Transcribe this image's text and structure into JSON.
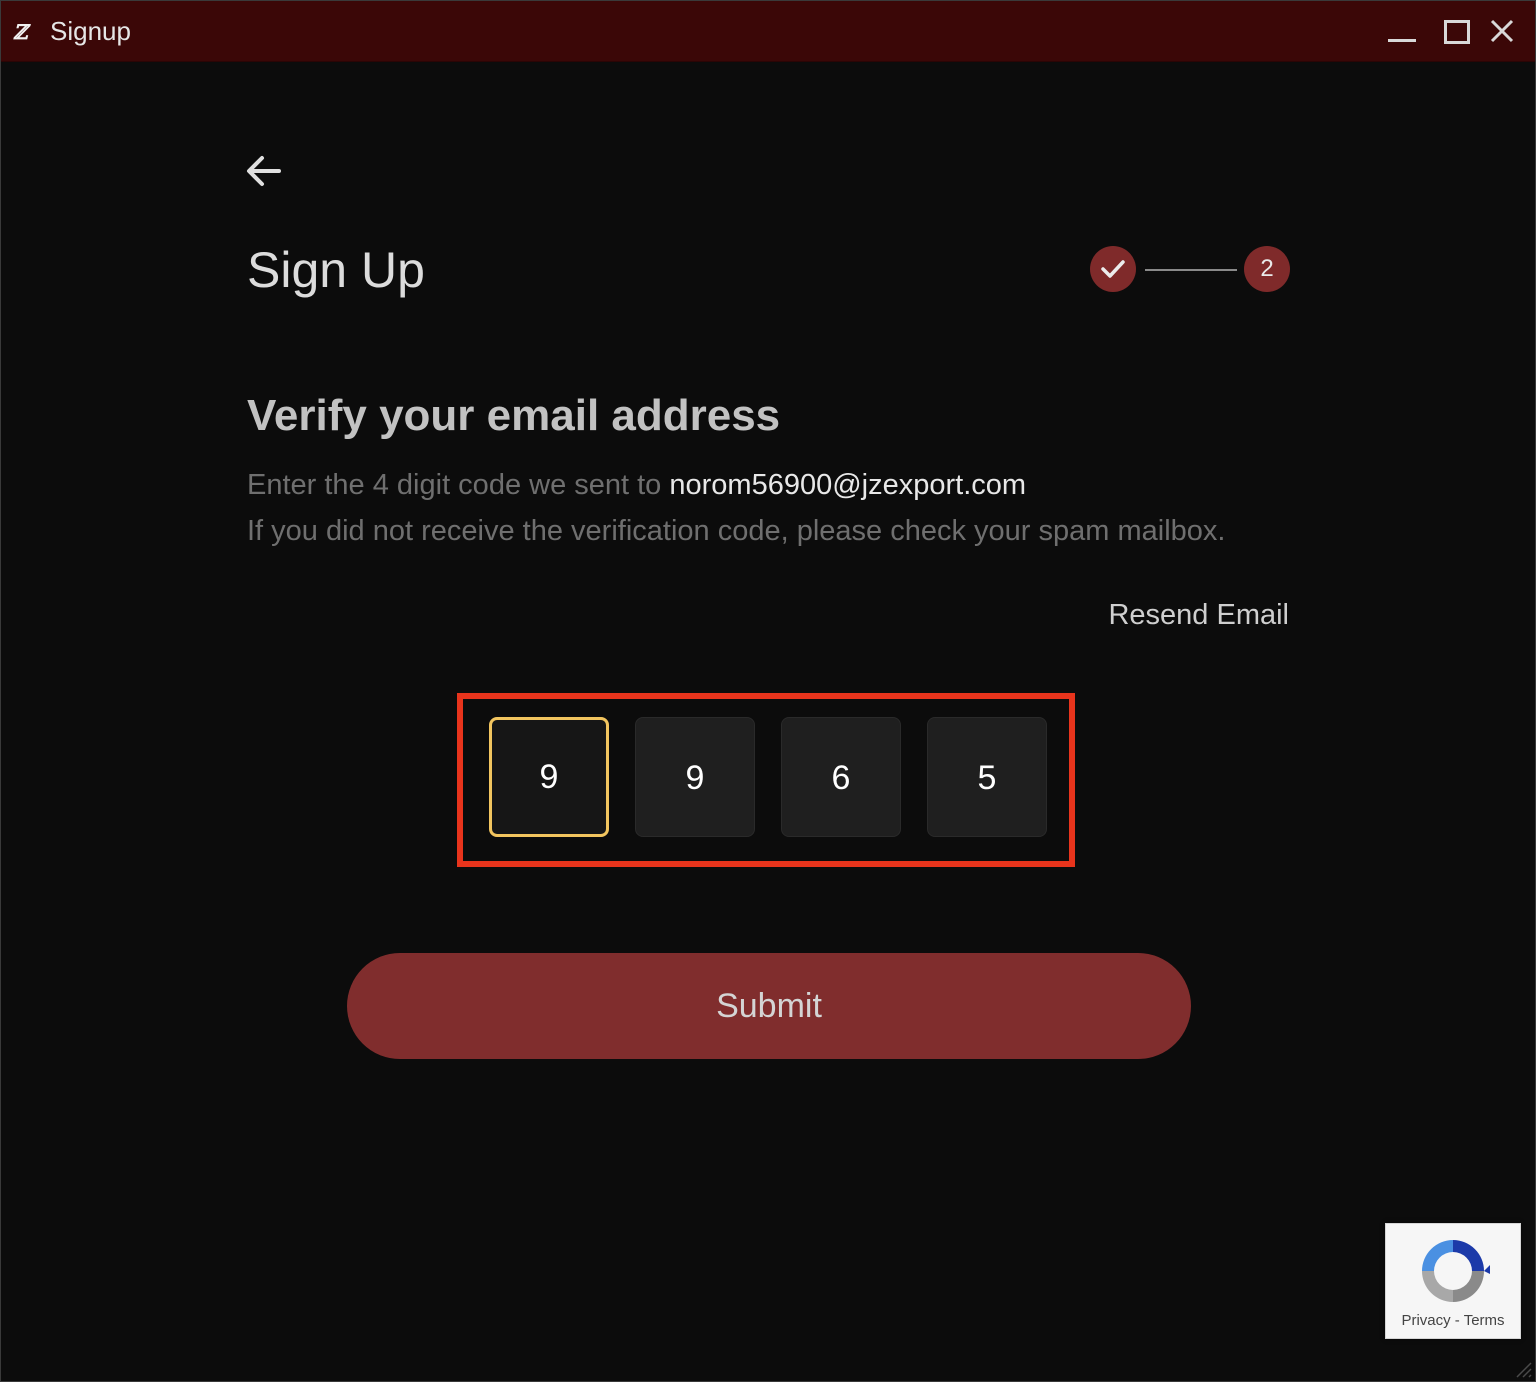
{
  "window": {
    "title": "Signup",
    "controls": [
      "minimize-icon",
      "maximize-icon",
      "close-icon"
    ],
    "titlebar_color": "#3b0707"
  },
  "header": {
    "back_icon": "arrow-left-icon",
    "title": "Sign Up",
    "steps": [
      {
        "state": "completed",
        "icon": "checkmark-icon"
      },
      {
        "state": "current",
        "label": "2"
      }
    ],
    "step_color": "#7f2a2a"
  },
  "verify": {
    "heading": "Verify your email address",
    "instruction_prefix": "Enter the 4 digit code we sent to ",
    "email": "norom56900@jzexport.com",
    "spam_note": "If you did not receive the verification code, please check your spam mailbox.",
    "resend_label": "Resend Email"
  },
  "code": {
    "digits": [
      "9",
      "9",
      "6",
      "5"
    ],
    "active_index": 0,
    "highlight_color": "#e8341c",
    "focus_color": "#f2c55f"
  },
  "submit": {
    "label": "Submit",
    "color": "#802d2d"
  },
  "recaptcha": {
    "icon": "recaptcha-logo-icon",
    "privacy_label": "Privacy",
    "separator": " - ",
    "terms_label": "Terms"
  }
}
